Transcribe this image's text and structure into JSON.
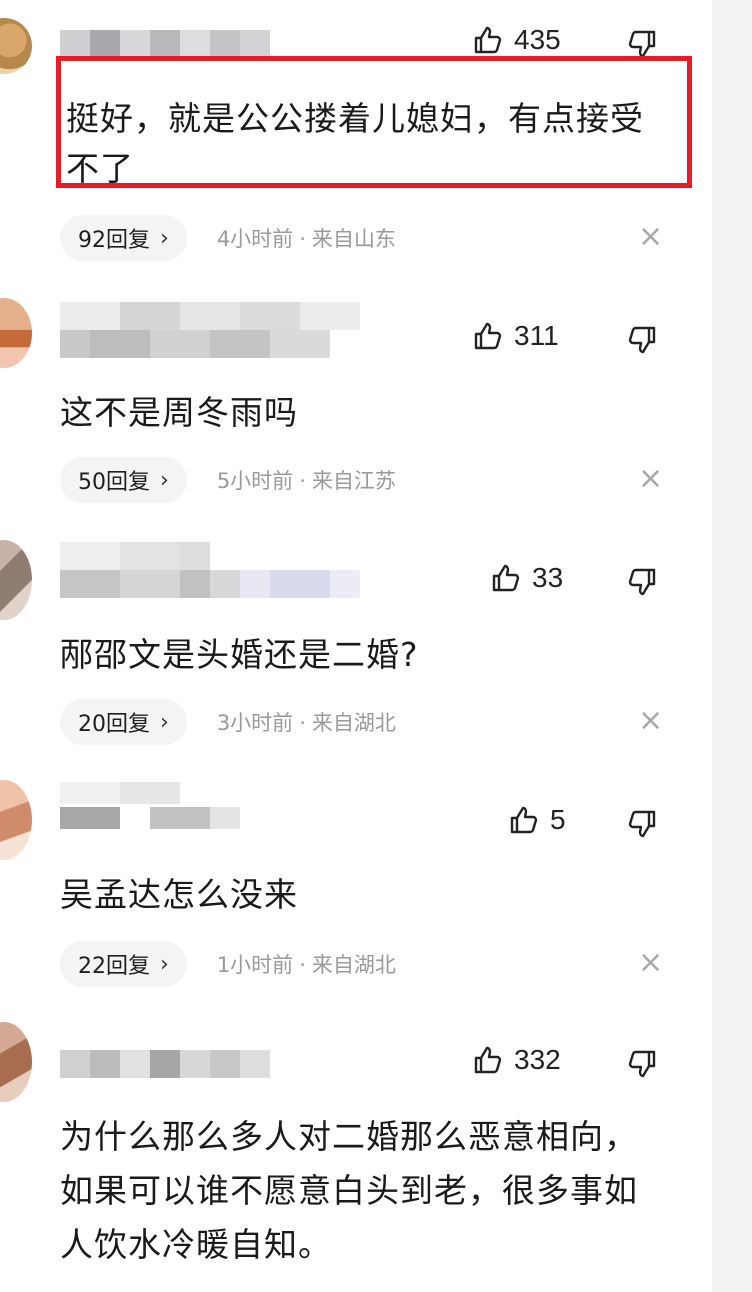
{
  "comments": [
    {
      "likes": "435",
      "text": "挺好，就是公公搂着儿媳妇，有点接受不了",
      "replies": "92回复",
      "time": "4小时前",
      "location": "来自山东"
    },
    {
      "likes": "311",
      "text": "这不是周冬雨吗",
      "replies": "50回复",
      "time": "5小时前",
      "location": "来自江苏"
    },
    {
      "likes": "33",
      "text": "邴邵文是头婚还是二婚?",
      "replies": "20回复",
      "time": "3小时前",
      "location": "来自湖北"
    },
    {
      "likes": "5",
      "text": "吴孟达怎么没来",
      "replies": "22回复",
      "time": "1小时前",
      "location": "来自湖北"
    },
    {
      "likes": "332",
      "text": "为什么那么多人对二婚那么恶意相向，如果可以谁不愿意白头到老，很多事如人饮水冷暖自知。"
    }
  ],
  "icons": {
    "like": "thumbs-up-icon",
    "dislike": "thumbs-down-icon",
    "close": "close-icon",
    "chevron": "chevron-right-icon"
  },
  "colors": {
    "highlight_border": "#e41e26",
    "meta_text": "#9a9a9a",
    "reply_pill_bg": "#f4f4f6"
  }
}
